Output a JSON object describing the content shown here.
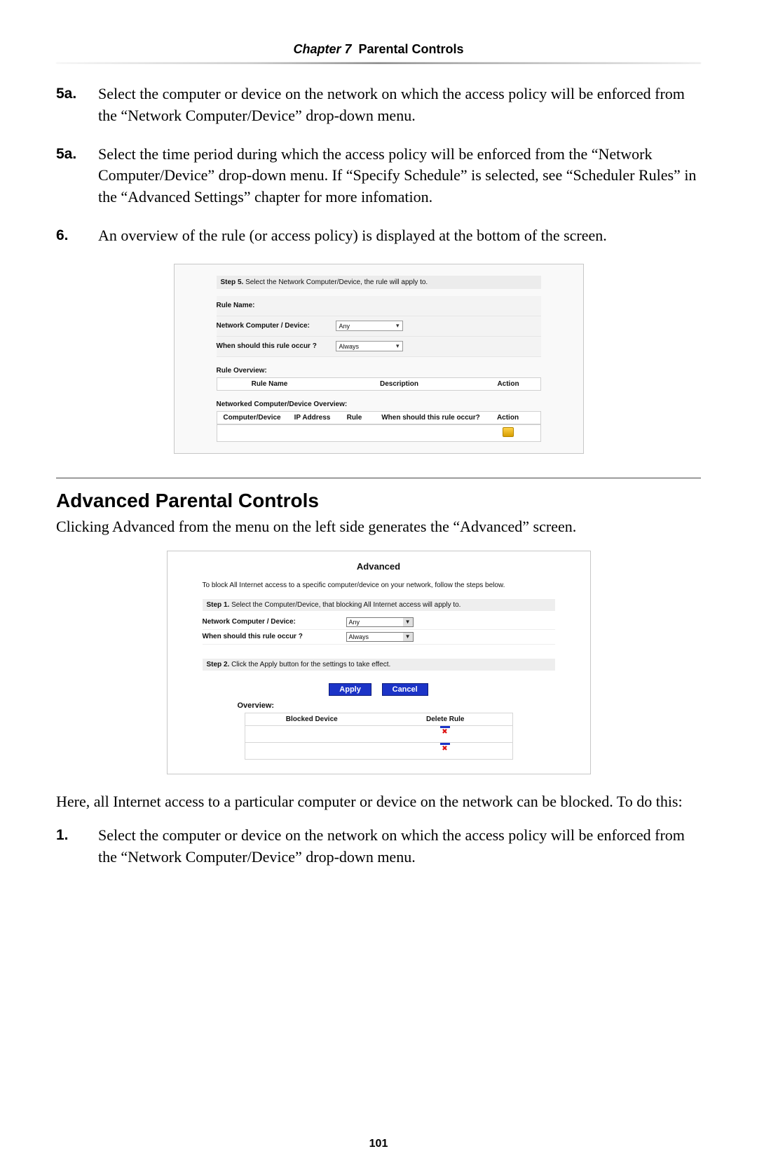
{
  "chapter": {
    "prefix": "Chapter 7",
    "title": "Parental Controls"
  },
  "steps_top": [
    {
      "num": "5a.",
      "text": "Select the computer or device on the network on which the access policy will be enforced from the “Network Computer/Device” drop-down menu."
    },
    {
      "num": "5a.",
      "text": "Select the time period during which the access policy will be enforced from the “Network Computer/Device” drop-down menu. If “Specify Schedule” is selected, see “Scheduler Rules” in the “Advanced Settings” chapter for more infomation."
    },
    {
      "num": "6.",
      "text": "An overview of the rule (or access policy) is displayed at the bottom of the screen."
    }
  ],
  "figure1": {
    "step_label": "Step 5.",
    "step_text": "Select the Network Computer/Device, the rule will apply to.",
    "rule_name_label": "Rule Name:",
    "device_label": "Network Computer / Device:",
    "device_value": "Any",
    "when_label": "When should this rule occur ?",
    "when_value": "Always",
    "ov_label": "Rule Overview:",
    "ov_cols": {
      "rule": "Rule Name",
      "desc": "Description",
      "action": "Action"
    },
    "ov2_label": "Networked Computer/Device Overview:",
    "ov2_cols": {
      "device": "Computer/Device",
      "ip": "IP Address",
      "rule": "Rule",
      "when": "When should this rule occur?",
      "action": "Action"
    }
  },
  "section_heading": "Advanced Parental Controls",
  "section_intro": "Clicking Advanced from the menu on the left side generates the “Advanced” screen.",
  "figure2": {
    "title": "Advanced",
    "intro": "To block All Internet access to a specific computer/device on your network, follow the steps below.",
    "step1_label": "Step 1.",
    "step1_text": "Select the Computer/Device, that blocking All Internet access will apply to.",
    "device_label": "Network Computer / Device:",
    "device_value": "Any",
    "when_label": "When should this rule occur ?",
    "when_value": "Always",
    "step2_label": "Step 2.",
    "step2_text": "Click the Apply button for the settings to take effect.",
    "apply_label": "Apply",
    "cancel_label": "Cancel",
    "ov_label": "Overview:",
    "ov_cols": {
      "device": "Blocked Device",
      "delete": "Delete Rule"
    }
  },
  "after_figure2": "Here, all Internet access to a particular computer or device on the network can be blocked. To do this:",
  "steps_bottom": [
    {
      "num": "1.",
      "text": "Select the computer or device on the network on which the access policy will be enforced from the “Network Computer/Device” drop-down menu."
    }
  ],
  "page_number": "101"
}
